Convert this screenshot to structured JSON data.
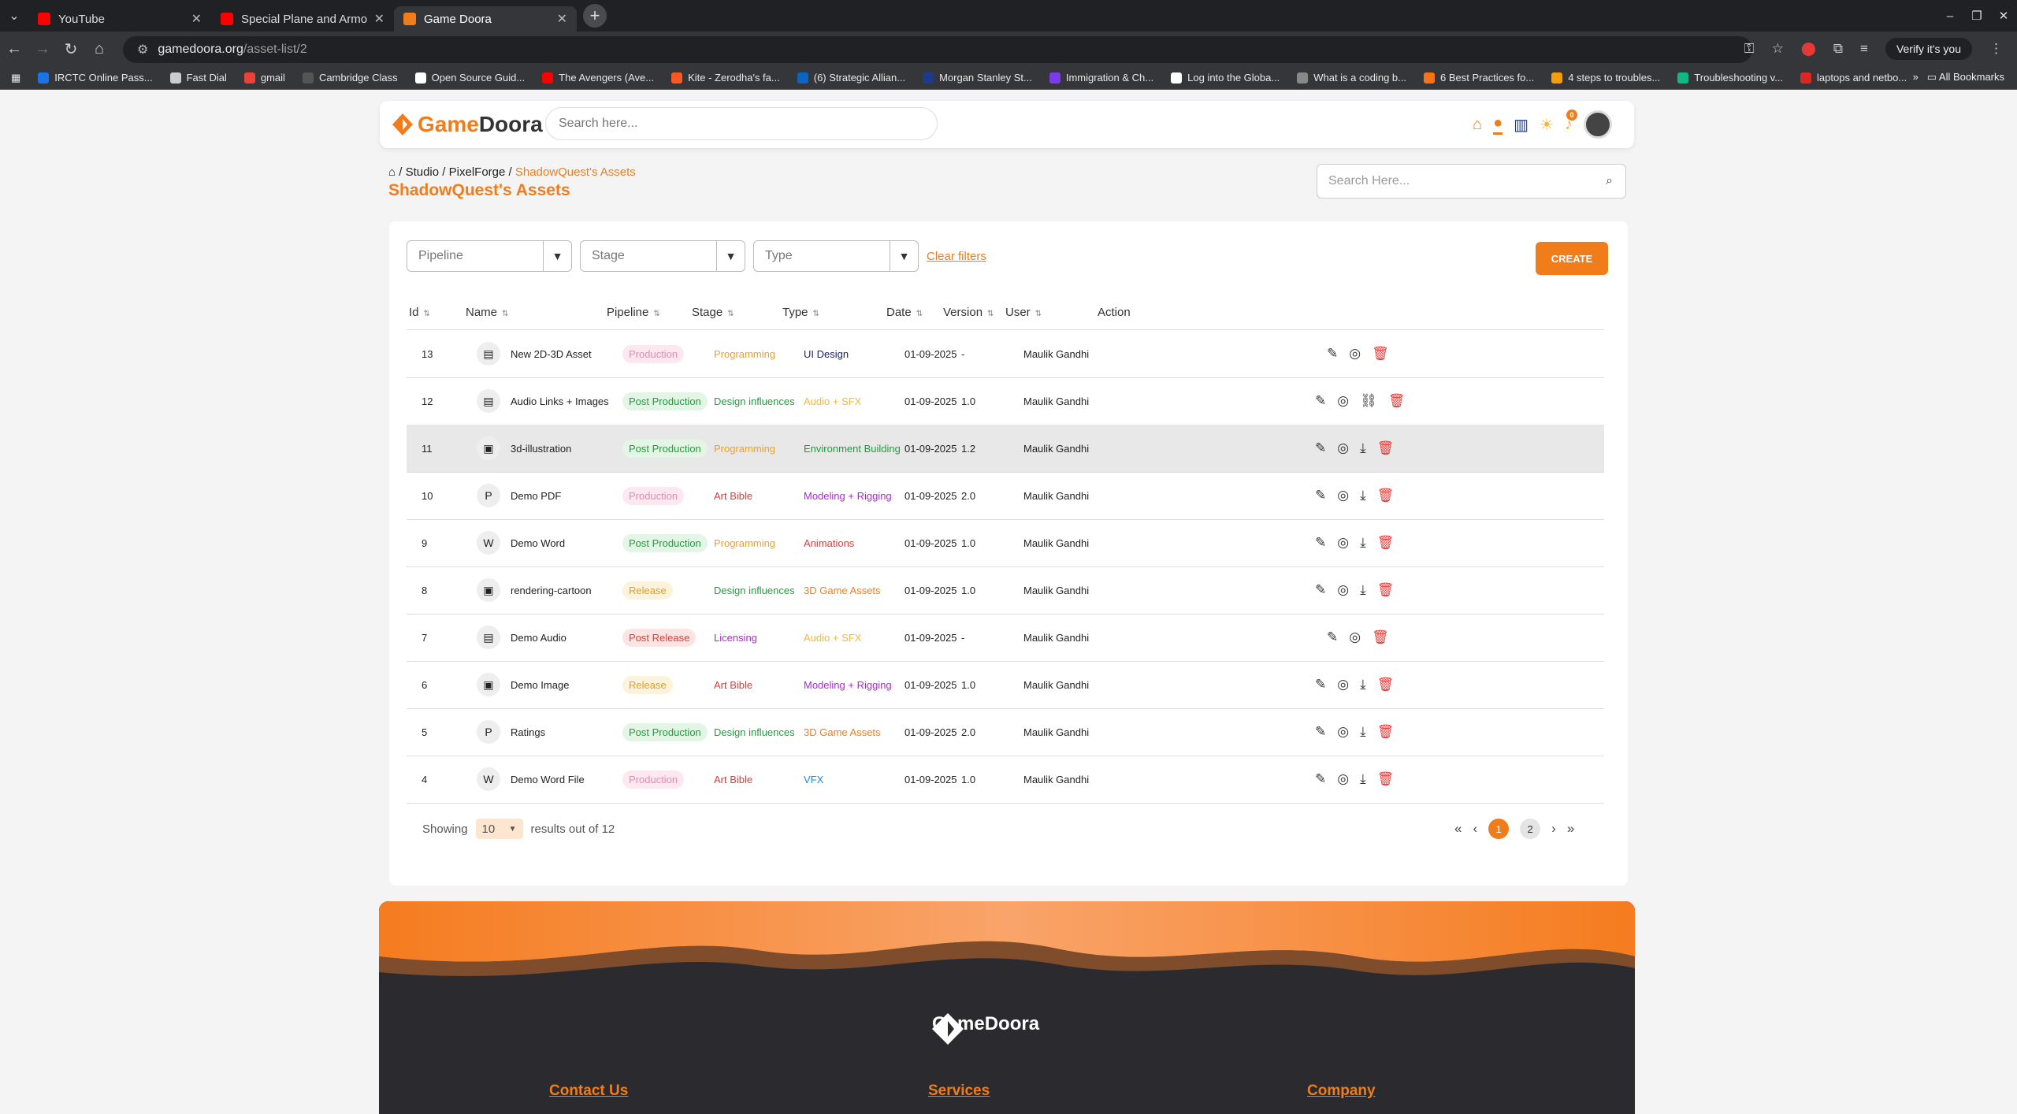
{
  "browser": {
    "tabs": [
      {
        "title": "YouTube",
        "favicon": "#ff0000"
      },
      {
        "title": "Special Plane and Armoured",
        "favicon": "#ff0000"
      },
      {
        "title": "Game Doora",
        "favicon": "#f07d1a",
        "active": true
      }
    ],
    "url_host": "gamedoora.org",
    "url_path": "/asset-list/2",
    "verify_label": "Verify it's you",
    "bookmarks": [
      "IRCTC Online Pass...",
      "Fast Dial",
      "gmail",
      "Cambridge Class",
      "Open Source Guid...",
      "The Avengers (Ave...",
      "Kite - Zerodha's fa...",
      "(6) Strategic Allian...",
      "Morgan Stanley St...",
      "Immigration & Ch...",
      "Log into the Globa...",
      "What is a coding b...",
      "6 Best Practices fo...",
      "4 steps to troubles...",
      "Troubleshooting v...",
      "laptops and netbo..."
    ],
    "bookmark_colors": [
      "#1a73e8",
      "#cccccc",
      "#ea4335",
      "#555555",
      "#ffffff",
      "#ff0000",
      "#ff5722",
      "#0a66c2",
      "#1e3a8a",
      "#7c3aed",
      "#ffffff",
      "#888888",
      "#f97316",
      "#f59e0b",
      "#10b981",
      "#dc2626"
    ],
    "all_bookmarks": "All Bookmarks"
  },
  "nav": {
    "logo_a": "Game",
    "logo_b": "Doora",
    "search_placeholder": "Search here...",
    "notification_count": "0"
  },
  "breadcrumb": {
    "items": [
      "Studio",
      "PixelForge"
    ],
    "current": "ShadowQuest's Assets"
  },
  "page_title": "ShadowQuest's Assets",
  "page_search_placeholder": "Search Here...",
  "filters": {
    "pipeline": "Pipeline",
    "stage": "Stage",
    "type": "Type",
    "clear": "Clear filters",
    "create": "CREATE"
  },
  "columns": [
    "Id",
    "Name",
    "Pipeline",
    "Stage",
    "Type",
    "Date",
    "Version",
    "User",
    "Action"
  ],
  "rows": [
    {
      "id": "13",
      "name": "New 2D-3D Asset",
      "icon": "document-icon",
      "pipeline": "Production",
      "stage": "Programming",
      "type": "UI Design",
      "date": "01-09-2025",
      "version": "-",
      "user": "Maulik Gandhi",
      "actions": [
        "edit",
        "view",
        "delete"
      ]
    },
    {
      "id": "12",
      "name": "Audio Links + Images",
      "icon": "document-icon",
      "pipeline": "Post Production",
      "stage": "Design influences",
      "type": "Audio + SFX",
      "date": "01-09-2025",
      "version": "1.0",
      "user": "Maulik Gandhi",
      "actions": [
        "edit",
        "view",
        "link",
        "delete"
      ]
    },
    {
      "id": "11",
      "name": "3d-illustration",
      "icon": "image-icon",
      "pipeline": "Post Production",
      "stage": "Programming",
      "type": "Environment Building",
      "date": "01-09-2025",
      "version": "1.2",
      "user": "Maulik Gandhi",
      "actions": [
        "edit",
        "view",
        "download",
        "delete"
      ],
      "highlight": true
    },
    {
      "id": "10",
      "name": "Demo PDF",
      "icon": "pdf-icon",
      "pipeline": "Production",
      "stage": "Art Bible",
      "type": "Modeling + Rigging",
      "date": "01-09-2025",
      "version": "2.0",
      "user": "Maulik Gandhi",
      "actions": [
        "edit",
        "view",
        "download",
        "delete"
      ]
    },
    {
      "id": "9",
      "name": "Demo Word",
      "icon": "word-icon",
      "pipeline": "Post Production",
      "stage": "Programming",
      "type": "Animations",
      "date": "01-09-2025",
      "version": "1.0",
      "user": "Maulik Gandhi",
      "actions": [
        "edit",
        "view",
        "download",
        "delete"
      ]
    },
    {
      "id": "8",
      "name": "rendering-cartoon",
      "icon": "image-icon",
      "pipeline": "Release",
      "stage": "Design influences",
      "type": "3D Game Assets",
      "date": "01-09-2025",
      "version": "1.0",
      "user": "Maulik Gandhi",
      "actions": [
        "edit",
        "view",
        "download",
        "delete"
      ]
    },
    {
      "id": "7",
      "name": "Demo Audio",
      "icon": "document-icon",
      "pipeline": "Post Release",
      "stage": "Licensing",
      "type": "Audio + SFX",
      "date": "01-09-2025",
      "version": "-",
      "user": "Maulik Gandhi",
      "actions": [
        "edit",
        "view",
        "delete"
      ]
    },
    {
      "id": "6",
      "name": "Demo Image",
      "icon": "image-icon",
      "pipeline": "Release",
      "stage": "Art Bible",
      "type": "Modeling + Rigging",
      "date": "01-09-2025",
      "version": "1.0",
      "user": "Maulik Gandhi",
      "actions": [
        "edit",
        "view",
        "download",
        "delete"
      ]
    },
    {
      "id": "5",
      "name": "Ratings",
      "icon": "pdf-icon",
      "pipeline": "Post Production",
      "stage": "Design influences",
      "type": "3D Game Assets",
      "date": "01-09-2025",
      "version": "2.0",
      "user": "Maulik Gandhi",
      "actions": [
        "edit",
        "view",
        "download",
        "delete"
      ]
    },
    {
      "id": "4",
      "name": "Demo Word File",
      "icon": "word-icon",
      "pipeline": "Production",
      "stage": "Art Bible",
      "type": "VFX",
      "date": "01-09-2025",
      "version": "1.0",
      "user": "Maulik Gandhi",
      "actions": [
        "edit",
        "view",
        "download",
        "delete"
      ]
    }
  ],
  "colors": {
    "accent": "#f07d1a",
    "pipeline": {
      "Production": {
        "fg": "#e889b0",
        "bg": "#fde8f0"
      },
      "Post Production": {
        "fg": "#1e9e3a",
        "bg": "#e3f6e6"
      },
      "Release": {
        "fg": "#e0a020",
        "bg": "#fdf3dc"
      },
      "Post Release": {
        "fg": "#e53935",
        "bg": "#fde4e3"
      }
    },
    "stage": {
      "Programming": "#f0a020",
      "Design influences": "#1e9e3a",
      "Art Bible": "#e53935",
      "Licensing": "#b620e0"
    },
    "type": {
      "UI Design": "#1a237e",
      "Audio + SFX": "#f7b733",
      "Environment Building": "#1e9e3a",
      "Modeling + Rigging": "#b620e0",
      "Animations": "#e53935",
      "3D Game Assets": "#f07d1a",
      "VFX": "#1e88e5"
    }
  },
  "pagination": {
    "showing": "Showing",
    "per_page": "10",
    "results": "results out of 12",
    "pages": [
      "1",
      "2"
    ],
    "current": "1"
  },
  "footer": {
    "logo": "GameDoora",
    "links": [
      "Contact Us",
      "Services",
      "Company"
    ]
  }
}
